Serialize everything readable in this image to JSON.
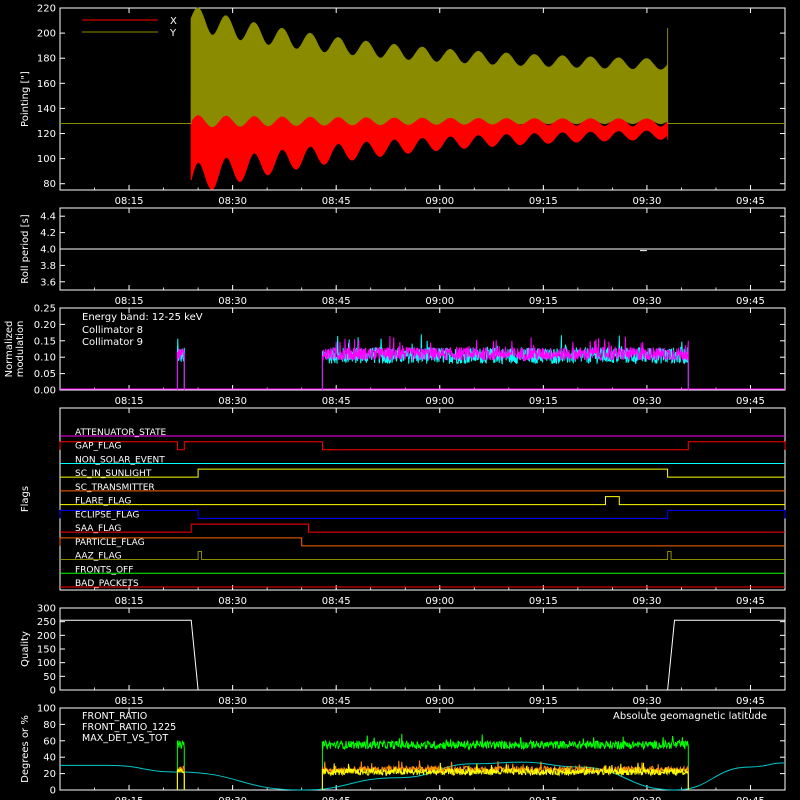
{
  "chart_data": [
    {
      "type": "line",
      "ylabel": "Pointing [\"]",
      "ylim": [
        75,
        220
      ],
      "yticks": [
        80,
        100,
        120,
        140,
        160,
        180,
        200,
        220
      ],
      "xlim": [
        "08:05",
        "09:50"
      ],
      "xticks": [
        "08:15",
        "08:30",
        "08:45",
        "09:00",
        "09:15",
        "09:30",
        "09:45"
      ],
      "legend": "top-left",
      "series": [
        {
          "name": "X",
          "color": "#ff0000",
          "baseline": 128,
          "active": [
            "08:24",
            "09:33"
          ],
          "upper_start": 150,
          "upper_end": 128,
          "lower_start": 83,
          "lower_end": 122
        },
        {
          "name": "Y",
          "color": "#8b8b00",
          "baseline": 128,
          "active": [
            "08:24",
            "09:33"
          ],
          "upper_start": 212,
          "upper_end": 172,
          "lower_start": 130,
          "lower_end": 130
        }
      ]
    },
    {
      "type": "line",
      "ylabel": "Roll period [s]",
      "ylim": [
        3.5,
        4.5
      ],
      "yticks": [
        "3.6",
        "3.8",
        "4.0",
        "4.2",
        "4.4"
      ],
      "xticks": [
        "08:15",
        "08:30",
        "08:45",
        "09:00",
        "09:15",
        "09:30",
        "09:45"
      ],
      "series": [
        {
          "color": "#ffffff",
          "value": 4.0
        }
      ]
    },
    {
      "type": "line",
      "ylabel": [
        "Normalized",
        "modulation"
      ],
      "ylim": [
        0,
        0.25
      ],
      "yticks": [
        "0.00",
        "0.05",
        "0.10",
        "0.15",
        "0.20",
        "0.25"
      ],
      "xticks": [
        "08:15",
        "08:30",
        "08:45",
        "09:00",
        "09:15",
        "09:30",
        "09:45"
      ],
      "annotation": "Energy band: 12-25 keV",
      "series": [
        {
          "name": "Collimator 8",
          "color": "#00ffff",
          "segments": [
            [
              "08:22",
              "08:23"
            ],
            [
              "08:43",
              "09:36"
            ]
          ],
          "mean": 0.105,
          "spread": 0.025
        },
        {
          "name": "Collimator 9",
          "color": "#ff00ff",
          "segments": [
            [
              "08:22",
              "08:23"
            ],
            [
              "08:43",
              "09:36"
            ]
          ],
          "mean": 0.11,
          "spread": 0.02
        }
      ]
    },
    {
      "type": "line",
      "ylabel": "Flags",
      "xticks": [
        "08:15",
        "08:30",
        "08:45",
        "09:00",
        "09:15",
        "09:30",
        "09:45"
      ],
      "flags": [
        {
          "name": "ATTENUATOR_STATE",
          "color": "#ff00ff",
          "high": []
        },
        {
          "name": "GAP_FLAG",
          "color": "#ff0000",
          "high": [
            [
              "08:05",
              "08:22"
            ],
            [
              "08:23",
              "08:43"
            ],
            [
              "09:36",
              "09:50"
            ]
          ]
        },
        {
          "name": "NON_SOLAR_EVENT",
          "color": "#00ffff",
          "high": []
        },
        {
          "name": "SC_IN_SUNLIGHT",
          "color": "#ffff00",
          "high": [
            [
              "08:25",
              "09:33"
            ]
          ]
        },
        {
          "name": "SC_TRANSMITTER",
          "color": "#ff6400",
          "high": []
        },
        {
          "name": "FLARE_FLAG",
          "color": "#ffff00",
          "high": [
            [
              "09:24",
              "09:26"
            ]
          ]
        },
        {
          "name": "ECLIPSE_FLAG",
          "color": "#0000ff",
          "high": [
            [
              "08:05",
              "08:25"
            ],
            [
              "09:33",
              "09:50"
            ]
          ]
        },
        {
          "name": "SAA_FLAG",
          "color": "#ff0000",
          "high": [
            [
              "08:24",
              "08:41"
            ]
          ]
        },
        {
          "name": "PARTICLE_FLAG",
          "color": "#ff6400",
          "high": [
            [
              "08:05",
              "08:40"
            ]
          ]
        },
        {
          "name": "AAZ_FLAG",
          "color": "#8b8b00",
          "high": [
            [
              "08:25",
              "08:25.5"
            ],
            [
              "09:33",
              "09:33.5"
            ]
          ]
        },
        {
          "name": "FRONTS_OFF",
          "color": "#00ff00",
          "high": []
        },
        {
          "name": "BAD_PACKETS",
          "color": "#ff0000",
          "high": []
        }
      ]
    },
    {
      "type": "line",
      "ylabel": "Quality",
      "ylim": [
        0,
        300
      ],
      "yticks": [
        "0",
        "50",
        "100",
        "150",
        "200",
        "250",
        "300"
      ],
      "xticks": [
        "08:15",
        "08:30",
        "08:45",
        "09:00",
        "09:15",
        "09:30",
        "09:45"
      ],
      "series": [
        {
          "color": "#ffffff",
          "steps": [
            [
              "08:05",
              255
            ],
            [
              "08:24",
              255
            ],
            [
              "08:25",
              0
            ],
            [
              "09:33",
              0
            ],
            [
              "09:34",
              255
            ],
            [
              "09:50",
              255
            ]
          ]
        }
      ]
    },
    {
      "type": "line",
      "ylabel": "Degrees or %",
      "ylim": [
        0,
        100
      ],
      "yticks": [
        "0",
        "20",
        "40",
        "60",
        "80",
        "100"
      ],
      "xticks": [
        "08:15",
        "08:30",
        "08:45",
        "09:00",
        "09:15",
        "09:30",
        "09:45"
      ],
      "annotation": "Absolute geomagnetic latitude",
      "annotation_color": "#00ffff",
      "series": [
        {
          "name": "FRONT_RATIO",
          "color": "#ffff00",
          "segments": [
            [
              "08:22",
              "08:23"
            ],
            [
              "08:43",
              "09:36"
            ]
          ],
          "mean": 22,
          "spread": 4
        },
        {
          "name": "FRONT_RATIO_1225",
          "color": "#00ff00",
          "segments": [
            [
              "08:22",
              "08:23"
            ],
            [
              "08:43",
              "09:36"
            ]
          ],
          "mean": 55,
          "spread": 5
        },
        {
          "name": "MAX_DET_VS_TOT",
          "color": "#ff8c00",
          "segments": [
            [
              "08:22",
              "08:23"
            ],
            [
              "08:43",
              "09:36"
            ]
          ],
          "mean": 25,
          "spread": 4
        },
        {
          "name": "",
          "color": "#00c8c8",
          "curve": [
            [
              "08:05",
              30
            ],
            [
              "08:12",
              30
            ],
            [
              "08:22",
              22
            ],
            [
              "08:40",
              0
            ],
            [
              "08:54",
              15
            ],
            [
              "09:05",
              32
            ],
            [
              "09:12",
              34
            ],
            [
              "09:20",
              28
            ],
            [
              "09:34",
              0
            ],
            [
              "09:45",
              28
            ],
            [
              "09:50",
              33
            ]
          ]
        }
      ]
    }
  ]
}
